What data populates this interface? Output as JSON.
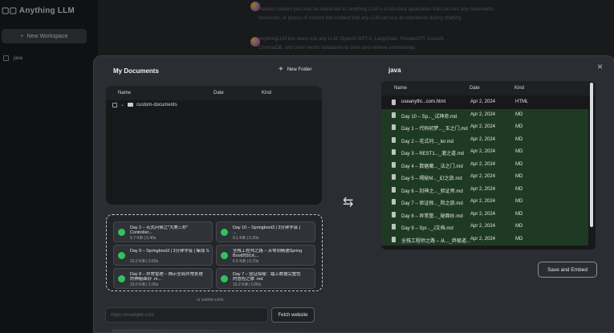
{
  "app": {
    "logo_text": "Anything LLM",
    "new_workspace_label": "New Workspace",
    "workspace_name": "java",
    "chat_lines": [
      "Related content you may be interested in: Anything LLM is a full-stack application that can turn any documents,",
      "resources, or pieces of content into context that any LLM can use as references during chatting.",
      "AnythingLLM lets users use any LLM: OpenAI GPT-4, LangChain, PrivateGPT, LocalAI,",
      "ChromaDB, and other vector databases to store and retrieve embeddings."
    ]
  },
  "modal": {
    "my_documents_title": "My Documents",
    "new_folder_label": "New Folder",
    "left_table_headers": [
      "Name",
      "Date",
      "Kind"
    ],
    "folder_name": "custom-documents",
    "upload_cards": [
      {
        "title1": "Day 2 – 花式问候之\"大美三秒\"",
        "title2": "Controller...",
        "meta": "5.7 KiB | 0.40s"
      },
      {
        "title1": "Day 10 – Springboot3 | 3分钟学会 |",
        "title2": "...",
        "meta": "9.1 KiB | 0.20s"
      },
      {
        "title1": "Day 9 – Springboot3 | 3分钟学会 | 集成 S...",
        "title2": "",
        "meta": "23.2 KiB | 0.50s"
      },
      {
        "title1": "全栈工程师之路 – 从零到精通Spring",
        "title2": "Boot的50天...",
        "meta": "6.5 KiB | 0.70s"
      },
      {
        "title1": "Day 8 – 异常管理 – 揭示全局异常处理",
        "title2": "的神秘面纱 .m...",
        "meta": "19.0 KiB | 1.00s"
      },
      {
        "title1": "Day 7 – 验证探秘：踏上数据完整性",
        "title2": "的冒险之旅 .md",
        "meta": "16.2 KiB | 0.80s"
      }
    ],
    "or_submit_link": "or submit a link",
    "url_placeholder": "https://example.com",
    "fetch_label": "Fetch website",
    "workspace_title": "java",
    "right_table_headers": [
      "Name",
      "Date",
      "Kind"
    ],
    "workspace_docs": [
      {
        "name": "useanythi...com.html",
        "date": "Apr 2, 2024",
        "kind": "HTML",
        "pending": false
      },
      {
        "name": "Day 10 – Sp..._试神奇.md",
        "date": "Apr 2, 2024",
        "kind": "MD",
        "pending": true
      },
      {
        "name": "Day 1 – 代码初梦..._玉之门.md",
        "date": "Apr 2, 2024",
        "kind": "MD",
        "pending": true
      },
      {
        "name": "Day 2 – 花式问..._ler.md",
        "date": "Apr 2, 2024",
        "kind": "MD",
        "pending": true
      },
      {
        "name": "Day 3 – REST1..._灌之道.md",
        "date": "Apr 2, 2024",
        "kind": "MD",
        "pending": true
      },
      {
        "name": "Day 4 – 数据魔..._法之门.md",
        "date": "Apr 2, 2024",
        "kind": "MD",
        "pending": true
      },
      {
        "name": "Day 5 – 揭秘M..._幻之旅.md",
        "date": "Apr 2, 2024",
        "kind": "MD",
        "pending": true
      },
      {
        "name": "Day 6 – 封神之..._验证师.md",
        "date": "Apr 2, 2024",
        "kind": "MD",
        "pending": true
      },
      {
        "name": "Day 7 – 验证探..._险之旅.md",
        "date": "Apr 2, 2024",
        "kind": "MD",
        "pending": true
      },
      {
        "name": "Day 8 – 异常管..._秘面纱.md",
        "date": "Apr 2, 2024",
        "kind": "MD",
        "pending": true
      },
      {
        "name": "Day 9 – Spr..._J文档.md",
        "date": "Apr 2, 2024",
        "kind": "MD",
        "pending": true
      },
      {
        "name": "全栈工程师之路 – 从..._终极道...",
        "date": "Apr 2, 2024",
        "kind": "MD",
        "pending": true
      }
    ],
    "save_embed_label": "Save and Embed",
    "close_glyph": "×",
    "swap_glyph": "⇆"
  },
  "colors": {
    "pending_row": "#1f3a23",
    "success_badge": "#32c15f"
  }
}
